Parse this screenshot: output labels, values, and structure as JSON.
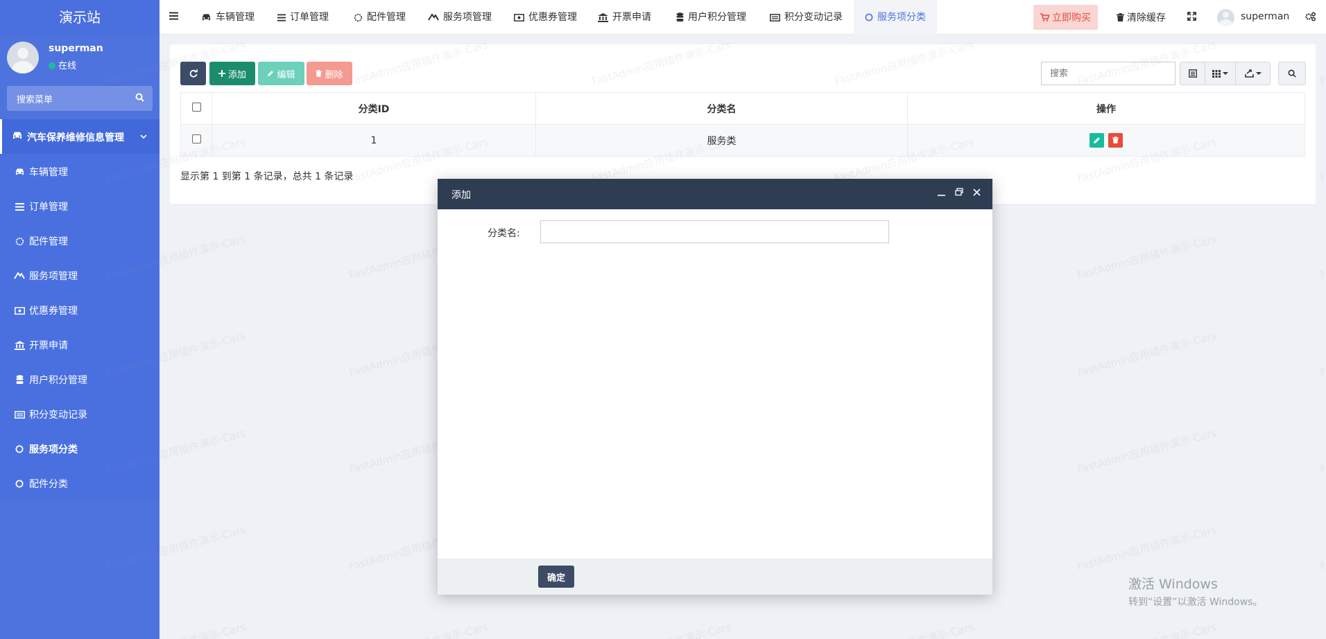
{
  "brand": "演示站",
  "user": {
    "name": "superman",
    "status": "在线"
  },
  "menu_search": {
    "placeholder": "搜索菜单"
  },
  "menu_group": {
    "label": "汽车保养维修信息管理"
  },
  "sidebar_items": [
    {
      "label": "车辆管理",
      "icon": "car-icon"
    },
    {
      "label": "订单管理",
      "icon": "list-icon"
    },
    {
      "label": "配件管理",
      "icon": "circle-o-icon"
    },
    {
      "label": "服务项管理",
      "icon": "tool-icon"
    },
    {
      "label": "优惠券管理",
      "icon": "coupon-icon"
    },
    {
      "label": "开票申请",
      "icon": "bank-icon"
    },
    {
      "label": "用户积分管理",
      "icon": "database-icon"
    },
    {
      "label": "积分变动记录",
      "icon": "record-icon"
    },
    {
      "label": "服务项分类",
      "icon": "circle-o-icon"
    },
    {
      "label": "配件分类",
      "icon": "circle-o-icon"
    }
  ],
  "nav_tabs": [
    {
      "label": "车辆管理"
    },
    {
      "label": "订单管理"
    },
    {
      "label": "配件管理"
    },
    {
      "label": "服务项管理"
    },
    {
      "label": "优惠券管理"
    },
    {
      "label": "开票申请"
    },
    {
      "label": "用户积分管理"
    },
    {
      "label": "积分变动记录"
    },
    {
      "label": "服务项分类"
    }
  ],
  "navbar": {
    "buy": "立即购买",
    "clear_cache": "清除缓存",
    "user": "superman"
  },
  "toolbar": {
    "add": "添加",
    "edit": "编辑",
    "delete": "删除",
    "search_placeholder": "搜索"
  },
  "table": {
    "headers": [
      "分类ID",
      "分类名",
      "操作"
    ],
    "rows": [
      {
        "id": "1",
        "name": "服务类"
      }
    ]
  },
  "pagination": {
    "info": "显示第 1 到第 1 条记录，总共 1 条记录"
  },
  "watermark": "FastAdmin应用插件演示-Cars",
  "modal": {
    "title": "添加",
    "field_label": "分类名:",
    "field_value": "",
    "submit": "确定"
  },
  "windows": {
    "line1": "激活 Windows",
    "line2": "转到“设置”以激活 Windows。"
  },
  "colors": {
    "sidebar": "#4e73df",
    "accent": "#4e73df",
    "success": "#18bc9c",
    "danger": "#e74c3c",
    "dark": "#3c4b66"
  }
}
